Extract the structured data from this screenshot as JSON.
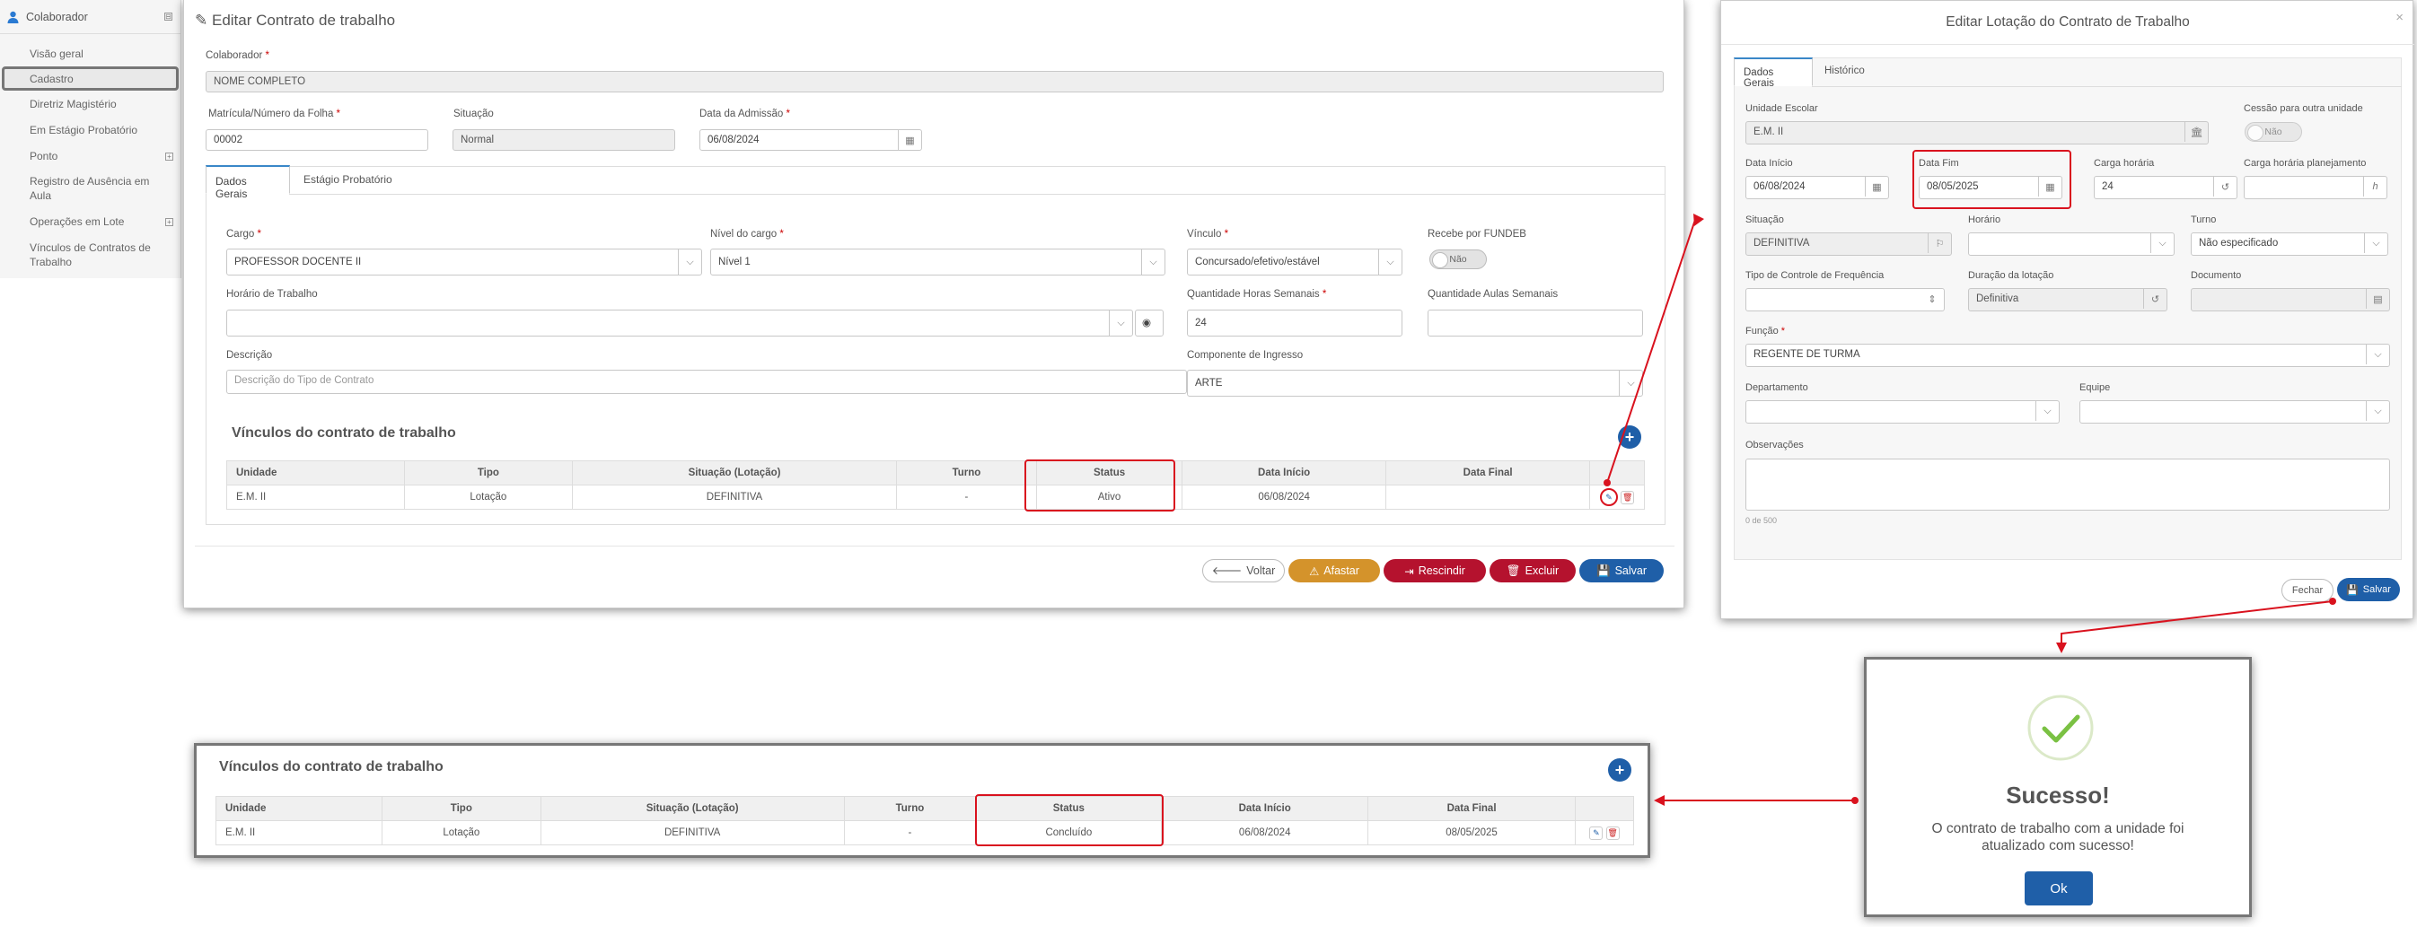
{
  "sidebar": {
    "title": "Colaborador",
    "toggle": "⊟",
    "items": [
      {
        "label": "Visão geral"
      },
      {
        "label": "Cadastro"
      },
      {
        "label": "Diretriz Magistério"
      },
      {
        "label": "Em Estágio Probatório"
      },
      {
        "label": "Ponto"
      },
      {
        "label": "Registro de Ausência em Aula"
      },
      {
        "label": "Operações em Lote"
      },
      {
        "label": "Vínculos de Contratos de Trabalho"
      }
    ]
  },
  "main": {
    "title": "Editar Contrato de trabalho",
    "colaborador": {
      "label": "Colaborador",
      "value": "NOME COMPLETO"
    },
    "matricula": {
      "label": "Matrícula/Número da Folha",
      "value": "00002"
    },
    "situacao": {
      "label": "Situação",
      "value": "Normal"
    },
    "admissao": {
      "label": "Data da Admissão",
      "value": "06/08/2024"
    },
    "tabs": [
      "Dados Gerais",
      "Estágio Probatório"
    ],
    "cargo": {
      "label": "Cargo",
      "value": "PROFESSOR DOCENTE II"
    },
    "nivel": {
      "label": "Nível do cargo",
      "value": "Nível 1"
    },
    "vinculo": {
      "label": "Vínculo",
      "value": "Concursado/efetivo/estável"
    },
    "fundeb": {
      "label": "Recebe por FUNDEB",
      "value": "Não"
    },
    "horario": {
      "label": "Horário de Trabalho"
    },
    "horas": {
      "label": "Quantidade Horas Semanais",
      "value": "24"
    },
    "aulas": {
      "label": "Quantidade Aulas Semanais"
    },
    "descricao": {
      "label": "Descrição",
      "placeholder": "Descrição do Tipo de Contrato"
    },
    "componente": {
      "label": "Componente de Ingresso",
      "value": "ARTE"
    },
    "vinculos_title": "Vínculos do contrato de trabalho",
    "table": {
      "headers": [
        "Unidade",
        "Tipo",
        "Situação (Lotação)",
        "Turno",
        "Status",
        "Data Início",
        "Data Final"
      ],
      "rows": [
        [
          "E.M. II",
          "Lotação",
          "DEFINITIVA",
          "-",
          "Ativo",
          "06/08/2024",
          ""
        ]
      ]
    },
    "buttons": {
      "voltar": "Voltar",
      "afastar": "Afastar",
      "rescindir": "Rescindir",
      "excluir": "Excluir",
      "salvar": "Salvar"
    }
  },
  "modal": {
    "title": "Editar Lotação do Contrato de Trabalho",
    "tabs": [
      "Dados Gerais",
      "Histórico"
    ],
    "unidade": {
      "label": "Unidade Escolar",
      "value": "E.M. II"
    },
    "cessao": {
      "label": "Cessão para outra unidade",
      "value": "Não"
    },
    "data_inicio": {
      "label": "Data Início",
      "value": "06/08/2024"
    },
    "data_fim": {
      "label": "Data Fim",
      "value": "08/05/2025"
    },
    "carga": {
      "label": "Carga horária",
      "value": "24"
    },
    "carga_plan": {
      "label": "Carga horária planejamento",
      "suffix": "h"
    },
    "situacao": {
      "label": "Situação",
      "value": "DEFINITIVA"
    },
    "horario": {
      "label": "Horário"
    },
    "turno": {
      "label": "Turno",
      "value": "Não especificado"
    },
    "controle": {
      "label": "Tipo de Controle de Frequência"
    },
    "duracao": {
      "label": "Duração da lotação",
      "value": "Definitiva"
    },
    "documento": {
      "label": "Documento"
    },
    "funcao": {
      "label": "Função",
      "value": "REGENTE DE TURMA"
    },
    "departamento": {
      "label": "Departamento"
    },
    "equipe": {
      "label": "Equipe"
    },
    "observacoes": {
      "label": "Observações",
      "counter": "0 de 500"
    },
    "fechar": "Fechar",
    "salvar": "Salvar"
  },
  "success": {
    "title": "Sucesso!",
    "message_line1": "O contrato de trabalho com a unidade foi",
    "message_line2": "atualizado com sucesso!",
    "ok": "Ok"
  },
  "result": {
    "title": "Vínculos do contrato de trabalho",
    "headers": [
      "Unidade",
      "Tipo",
      "Situação (Lotação)",
      "Turno",
      "Status",
      "Data Início",
      "Data Final"
    ],
    "rows": [
      [
        "E.M. II",
        "Lotação",
        "DEFINITIVA",
        "-",
        "Concluído",
        "06/08/2024",
        "08/05/2025"
      ]
    ]
  },
  "colors": {
    "primary": "#1f5fa8",
    "danger": "#b5122e",
    "warning": "#d4932b",
    "highlight": "#d9121e",
    "success_check": "#7ac143"
  }
}
